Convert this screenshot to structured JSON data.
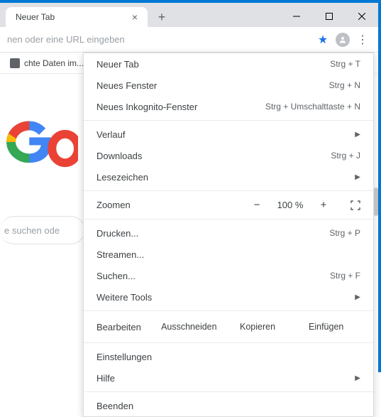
{
  "window": {
    "tab_title": "Neuer Tab",
    "new_tab_tooltip": "+"
  },
  "toolbar": {
    "omnibox_placeholder": "nen oder eine URL eingeben"
  },
  "bookmarks": {
    "item1": "chte Daten im..."
  },
  "content": {
    "search_stub": "e suchen ode"
  },
  "menu": {
    "new_tab": {
      "label": "Neuer Tab",
      "shortcut": "Strg + T"
    },
    "new_window": {
      "label": "Neues Fenster",
      "shortcut": "Strg + N"
    },
    "new_incognito": {
      "label": "Neues Inkognito-Fenster",
      "shortcut": "Strg + Umschalttaste + N"
    },
    "history": {
      "label": "Verlauf"
    },
    "downloads": {
      "label": "Downloads",
      "shortcut": "Strg + J"
    },
    "bookmarks": {
      "label": "Lesezeichen"
    },
    "zoom": {
      "label": "Zoomen",
      "value": "100 %"
    },
    "print": {
      "label": "Drucken...",
      "shortcut": "Strg + P"
    },
    "cast": {
      "label": "Streamen..."
    },
    "find": {
      "label": "Suchen...",
      "shortcut": "Strg + F"
    },
    "more_tools": {
      "label": "Weitere Tools"
    },
    "edit": {
      "label": "Bearbeiten",
      "cut": "Ausschneiden",
      "copy": "Kopieren",
      "paste": "Einfügen"
    },
    "settings": {
      "label": "Einstellungen"
    },
    "help": {
      "label": "Hilfe"
    },
    "exit": {
      "label": "Beenden"
    }
  }
}
